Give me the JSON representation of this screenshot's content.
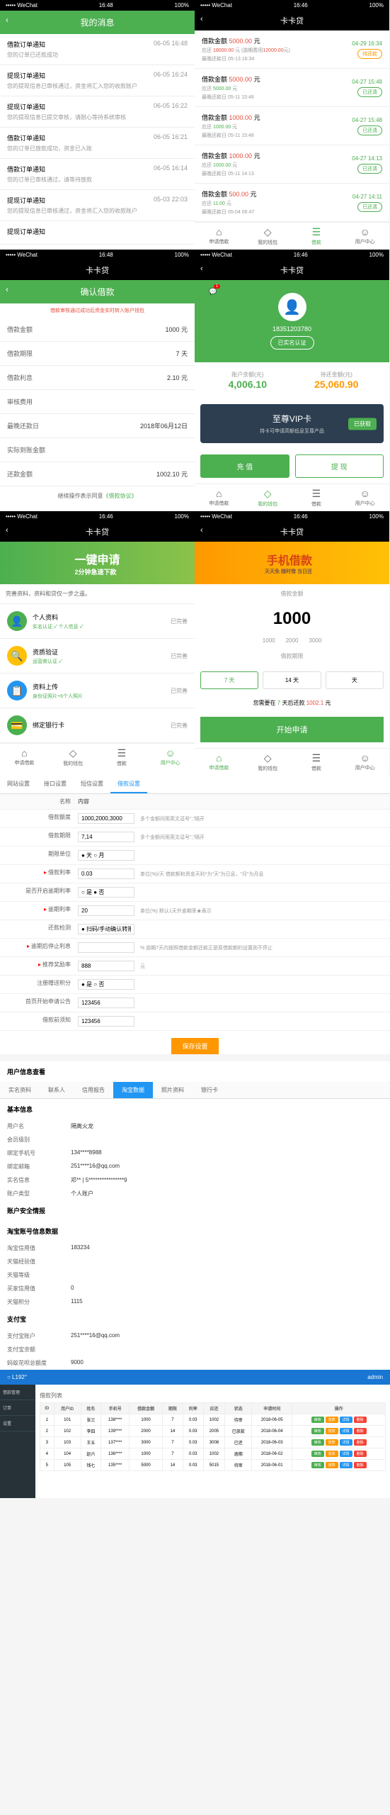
{
  "statusBar": {
    "carrier": "••••• WeChat",
    "time": "16:48",
    "battery": "100%",
    "time2": "16:46"
  },
  "appTitle": "卡卡贷",
  "screen1": {
    "title": "我的消息",
    "items": [
      {
        "title": "借款订单通知",
        "date": "06-05 16:48",
        "sub": "您的订单已还款成功"
      },
      {
        "title": "提现订单通知",
        "date": "06-05 16:24",
        "sub": "您的提现信息已审核通过，资金将汇入您的收款账户"
      },
      {
        "title": "提现订单通知",
        "date": "06-05 16:22",
        "sub": "您的提现信息已提交审核，请耐心等待系统审核"
      },
      {
        "title": "借款订单通知",
        "date": "06-05 16:21",
        "sub": "您的订单已放款成功，资金已入账"
      },
      {
        "title": "借款订单通知",
        "date": "06-05 16:14",
        "sub": "您的订单已审核通过，请等待放款"
      },
      {
        "title": "提现订单通知",
        "date": "05-03 22:03",
        "sub": "您的提现信息已审核通过，资金将汇入您的收款账户"
      },
      {
        "title": "提现订单通知",
        "date": "",
        "sub": ""
      }
    ]
  },
  "screen2": {
    "items": [
      {
        "amtLabel": "借款金额",
        "amt": "5000.00",
        "unit": "元",
        "date": "04-29 16:34",
        "l1": "应还",
        "v1": "18000.00",
        "l1b": "元 (逾期费用",
        "v1b": "12000.00",
        "l1c": "元)",
        "l2": "最晚还款日",
        "v2": "05-13 16:34",
        "badge": "待还款",
        "cls": "orange"
      },
      {
        "amtLabel": "借款金额",
        "amt": "5000.00",
        "unit": "元",
        "date": "04-27 15:48",
        "l1": "应还",
        "v1": "5000.00",
        "l1c": "元",
        "l2": "最晚还款日",
        "v2": "05-11 15:48",
        "badge": "已还清",
        "cls": ""
      },
      {
        "amtLabel": "借款金额",
        "amt": "1000.00",
        "unit": "元",
        "date": "04-27 15:48",
        "l1": "应还",
        "v1": "1000.00",
        "l1c": "元",
        "l2": "最晚还款日",
        "v2": "05-11 15:48",
        "badge": "已还清",
        "cls": ""
      },
      {
        "amtLabel": "借款金额",
        "amt": "1000.00",
        "unit": "元",
        "date": "04-27 14:13",
        "l1": "应还",
        "v1": "1000.00",
        "l1c": "元",
        "l2": "最晚还款日",
        "v2": "05-11 14:13",
        "badge": "已还清",
        "cls": ""
      },
      {
        "amtLabel": "借款金额",
        "amt": "500.00",
        "unit": "元",
        "date": "04-27 14:11",
        "l1": "应还",
        "v1": "11.00",
        "l1c": "元",
        "l2": "最晚还款日",
        "v2": "05-04 06:47",
        "badge": "已还清",
        "cls": ""
      }
    ]
  },
  "nav": {
    "i1": "申请借款",
    "i2": "我的钱包",
    "i3": "借款",
    "i4": "用户中心"
  },
  "screen3": {
    "title": "确认借款",
    "sub": "借款审核通过成功后资金实时转入账户钱包",
    "rows": [
      {
        "k": "借款金额",
        "v": "1000 元"
      },
      {
        "k": "借款期限",
        "v": "7 天"
      },
      {
        "k": "借款利息",
        "v": "2.10 元"
      },
      {
        "k": "审核费用",
        "v": ""
      },
      {
        "k": "最晚还款日",
        "v": "2018年06月12日"
      },
      {
        "k": "实际到账金额",
        "v": ""
      },
      {
        "k": "还款金额",
        "v": "1002.10 元"
      }
    ],
    "agree": "继续操作表示同意",
    "agreeLink": "《借款协议》"
  },
  "screen4": {
    "notifCount": "1",
    "phone": "18351203780",
    "realname": "已实名认证",
    "bal1Label": "账户余额(元)",
    "bal1": "4,006.10",
    "bal2Label": "待还金额(元)",
    "bal2": "25,060.90",
    "vipTitle": "至尊VIP卡",
    "vipSub": "持卡可申请高额低息至尊产品",
    "vipBtn": "已获取",
    "recharge": "充 值",
    "withdraw": "提 现"
  },
  "screen5": {
    "banner": "一键申请",
    "bannerSub": "2分钟急速下款",
    "hint": "完善资料，资料和贷仅一步之遥。",
    "tasks": [
      {
        "icon": "👤",
        "title": "个人资料",
        "sub": "实名认证 ✓ 个人信息 ✓",
        "status": "已完善",
        "bg": "#4CAF50"
      },
      {
        "icon": "🔍",
        "title": "资质验证",
        "sub": "运营商认证 ✓",
        "status": "已完善",
        "bg": "#FFC107"
      },
      {
        "icon": "📋",
        "title": "资料上传",
        "sub": "身份证照片+6个人照片",
        "status": "已完善",
        "bg": "#2196F3"
      },
      {
        "icon": "💳",
        "title": "绑定银行卡",
        "sub": "",
        "status": "已完善",
        "bg": "#4CAF50"
      }
    ]
  },
  "screen6": {
    "bannerT": "手机借款",
    "bannerS": "天天免 随时借 当日还",
    "amtLabel": "借款金额",
    "amt": "1000",
    "opts": [
      "1000",
      "2000",
      "3000"
    ],
    "periodLabel": "借款期限",
    "periods": [
      "7 天",
      "14 天",
      "天"
    ],
    "hint1": "您需要在",
    "hint2": "7",
    "hint3": "天后还款",
    "hint4": "1002.1",
    "hint5": "元",
    "applyBtn": "开始申请"
  },
  "adminTabs": [
    "网站设置",
    "接口设置",
    "短信设置",
    "借款设置"
  ],
  "adminCfg": {
    "header": {
      "c1": "名称",
      "c2": "内容"
    },
    "rows": [
      {
        "k": "借款额度",
        "v": "1000,2000,3000",
        "h": "多个金额间用英文逗号\",\"隔开"
      },
      {
        "k": "借款期限",
        "v": "7,14",
        "h": "多个金额间用英文逗号\",\"隔开"
      },
      {
        "k": "期限单位",
        "v": "● 天 ○ 月",
        "h": ""
      },
      {
        "k": "借款利率",
        "v": "0.03",
        "h": "单位(%)/天 借款额和资金天利*为\"天\"为日息，\"月\"为月息",
        "star": true
      },
      {
        "k": "是否开启逾期利率",
        "v": "○ 是 ● 否",
        "h": ""
      },
      {
        "k": "逾期利率",
        "v": "20",
        "h": "单位(%) 默认1天外逾期率★表示",
        "star": true
      },
      {
        "k": "还款检测",
        "v": "● 扫码/手动确认转账本金 ○ 钱包余额",
        "h": ""
      },
      {
        "k": "逾期后停止利息",
        "v": "",
        "h": "% 逾期7天内按照借款金额还款正是原借款额的设置则不停止",
        "star": true
      },
      {
        "k": "推荐奖励率",
        "v": "888",
        "h": "元",
        "star": true
      },
      {
        "k": "注册赠送积分",
        "v": "● 是 ○ 否",
        "h": ""
      },
      {
        "k": "首页开始申请公告",
        "v": "123456",
        "h": ""
      },
      {
        "k": "借款前须知",
        "v": "123456",
        "h": ""
      }
    ],
    "saveBtn": "保存设置"
  },
  "userView": {
    "title": "用户信息查看",
    "tabs": [
      "实名资料",
      "联系人",
      "信用报告",
      "淘宝数据",
      "照片资料",
      "银行卡"
    ],
    "sec1": "基本信息",
    "rows1": [
      {
        "k": "用户名",
        "v": "隔离火龙"
      },
      {
        "k": "会员级别",
        "v": ""
      },
      {
        "k": "绑定手机号",
        "v": "134****8988"
      },
      {
        "k": "绑定邮箱",
        "v": "251****16@qq.com"
      },
      {
        "k": "实名信息",
        "v": "邓** | 5****************9"
      },
      {
        "k": "账户类型",
        "v": "个人账户"
      }
    ],
    "sec2": "账户安全情报",
    "sec3": "淘宝账号信息数据",
    "rows3": [
      {
        "k": "淘宝信用值",
        "v": "183234"
      },
      {
        "k": "天猫经验值",
        "v": ""
      },
      {
        "k": "天猫等级",
        "v": ""
      },
      {
        "k": "买家信用值",
        "v": "0"
      },
      {
        "k": "天猫积分",
        "v": "1115"
      }
    ],
    "sec4": "支付宝",
    "rows4": [
      {
        "k": "支付宝账户",
        "v": "251****16@qq.com"
      },
      {
        "k": "支付宝余额",
        "v": ""
      }
    ],
    "sec5": "蚂蚁花呗总额度",
    "val5": "9000"
  },
  "blueAdmin": {
    "logo": "○ L192°",
    "user": "admin",
    "side": [
      "借款管理",
      "订单",
      "设置"
    ],
    "breadcrumb": "借款列表",
    "cols": [
      "ID",
      "用户ID",
      "姓名",
      "手机号",
      "借款金额",
      "期限",
      "利率",
      "应还",
      "状态",
      "申请时间",
      "操作"
    ],
    "rows": [
      [
        "1",
        "101",
        "张三",
        "138****",
        "1000",
        "7",
        "0.03",
        "1002",
        "待审",
        "2018-06-05"
      ],
      [
        "2",
        "102",
        "李四",
        "139****",
        "2000",
        "14",
        "0.03",
        "2005",
        "已放款",
        "2018-06-04"
      ],
      [
        "3",
        "103",
        "王五",
        "137****",
        "3000",
        "7",
        "0.03",
        "3008",
        "已还",
        "2018-06-03"
      ],
      [
        "4",
        "104",
        "赵六",
        "136****",
        "1000",
        "7",
        "0.03",
        "1002",
        "逾期",
        "2018-06-02"
      ],
      [
        "5",
        "105",
        "钱七",
        "135****",
        "5000",
        "14",
        "0.03",
        "5015",
        "待审",
        "2018-06-01"
      ]
    ],
    "ops": [
      "审核",
      "放款",
      "详情",
      "删除"
    ]
  }
}
